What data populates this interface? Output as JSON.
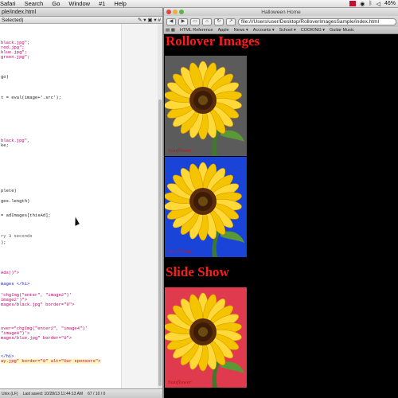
{
  "menubar": {
    "items": [
      "Safari",
      "Search",
      "Go",
      "Window",
      "#1",
      "Help"
    ],
    "battery": "46%"
  },
  "editor": {
    "title": "ple/index.html",
    "nav_left": "Selected)",
    "lines": [
      {
        "t": "black.jpg\";",
        "c": "c-str"
      },
      {
        "t": "red.jpg\";",
        "c": "c-str"
      },
      {
        "t": "blue.jpg\";",
        "c": "c-str"
      },
      {
        "t": "green.jpg\";",
        "c": "c-str"
      },
      {
        "t": "go)",
        "c": "c-plain"
      },
      {
        "t": "t = eval(image+'.src');",
        "c": "c-plain"
      },
      {
        "t": "black.jpg\",",
        "c": "c-str"
      },
      {
        "t": "ke;",
        "c": "c-plain"
      },
      {
        "t": "plete)",
        "c": "c-plain"
      },
      {
        "t": "ges.length)",
        "c": "c-plain"
      },
      {
        "t": "= adImages[thisAd];",
        "c": "c-plain"
      },
      {
        "t": "ry 3 seconds",
        "c": "c-cmt"
      },
      {
        "t": ");",
        "c": "c-plain"
      },
      {
        "t": "Ads()\">",
        "c": "c-str"
      },
      {
        "t": "mages </h1>",
        "c": "c-blue"
      },
      {
        "t": "'chgImg(\"enter\", \"image2\")'",
        "c": "c-str"
      },
      {
        "t": "image2')\">",
        "c": "c-str"
      },
      {
        "t": "mages/black.jpg\" border=\"0\">",
        "c": "c-str"
      },
      {
        "t": "over=\"chgImg(\"enter2\", \"image4\")'",
        "c": "c-str"
      },
      {
        "t": "\"image4\")'>",
        "c": "c-str"
      },
      {
        "t": "mages/blue.jpg\" border=\"0\">",
        "c": "c-str"
      },
      {
        "t": "</h1>",
        "c": "c-blue"
      },
      {
        "t": "ay.jpg\" border=\"0\" alt=\"Our sponsors\">",
        "c": "c-str"
      }
    ],
    "status": {
      "encoding": "Unix (LF)",
      "saved": "Last saved: 10/28/13 11:44:13 AM",
      "position": "67 / 10 / 0"
    }
  },
  "browser": {
    "window_title": "Halloween Home",
    "url": "file:///Users/user/Desktop/RolloverImagesSample/index.html",
    "bookmarks": [
      "HTML Reference",
      "Apple",
      "News ▾",
      "Accounts ▾",
      "School ▾",
      "COOKING ▾",
      "Guitar Music"
    ],
    "heading1": "Rollover Images",
    "heading2": "Slide Show",
    "flower_label": "Sunflower",
    "flowers": [
      {
        "bg": "#5b5b5b"
      },
      {
        "bg": "#1a44d8"
      },
      {
        "bg": "#e03a4e"
      }
    ]
  },
  "colors": {
    "heading": "#ff1a1a",
    "page_bg": "#000000"
  }
}
